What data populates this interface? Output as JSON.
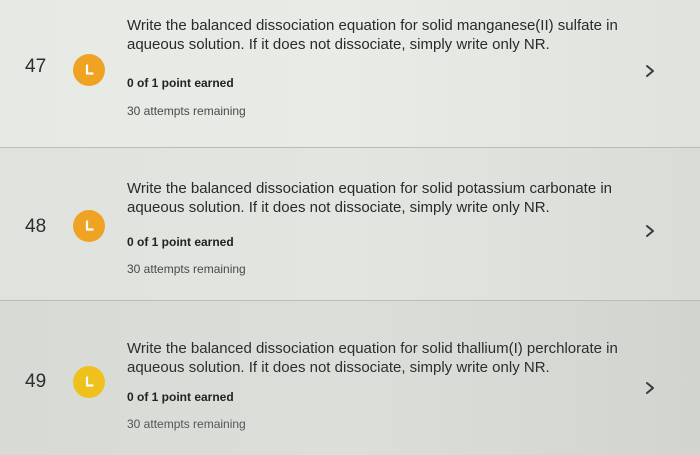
{
  "questions": [
    {
      "number": "47",
      "badge_letter": "L",
      "prompt": "Write the balanced dissociation equation for solid manganese(II) sulfate in aqueous solution. If it does not dissociate, simply write only NR.",
      "score": "0 of 1 point earned",
      "attempts": "30 attempts remaining"
    },
    {
      "number": "48",
      "badge_letter": "L",
      "prompt": "Write the balanced dissociation equation for solid potassium carbonate in aqueous solution. If it does not dissociate, simply write only NR.",
      "score": "0 of 1 point earned",
      "attempts": "30 attempts remaining"
    },
    {
      "number": "49",
      "badge_letter": "L",
      "prompt": "Write the balanced dissociation equation for solid thallium(I) perchlorate in aqueous solution. If it does not dissociate, simply write only NR.",
      "score": "0 of 1 point earned",
      "attempts": "30 attempts remaining"
    }
  ],
  "icons": {
    "badge": "lowercase-l-icon",
    "chevron": "chevron-right-icon"
  },
  "colors": {
    "badge_orange": "#f0a323",
    "badge_yellow": "#eec11d",
    "text": "#2a2a2a"
  }
}
